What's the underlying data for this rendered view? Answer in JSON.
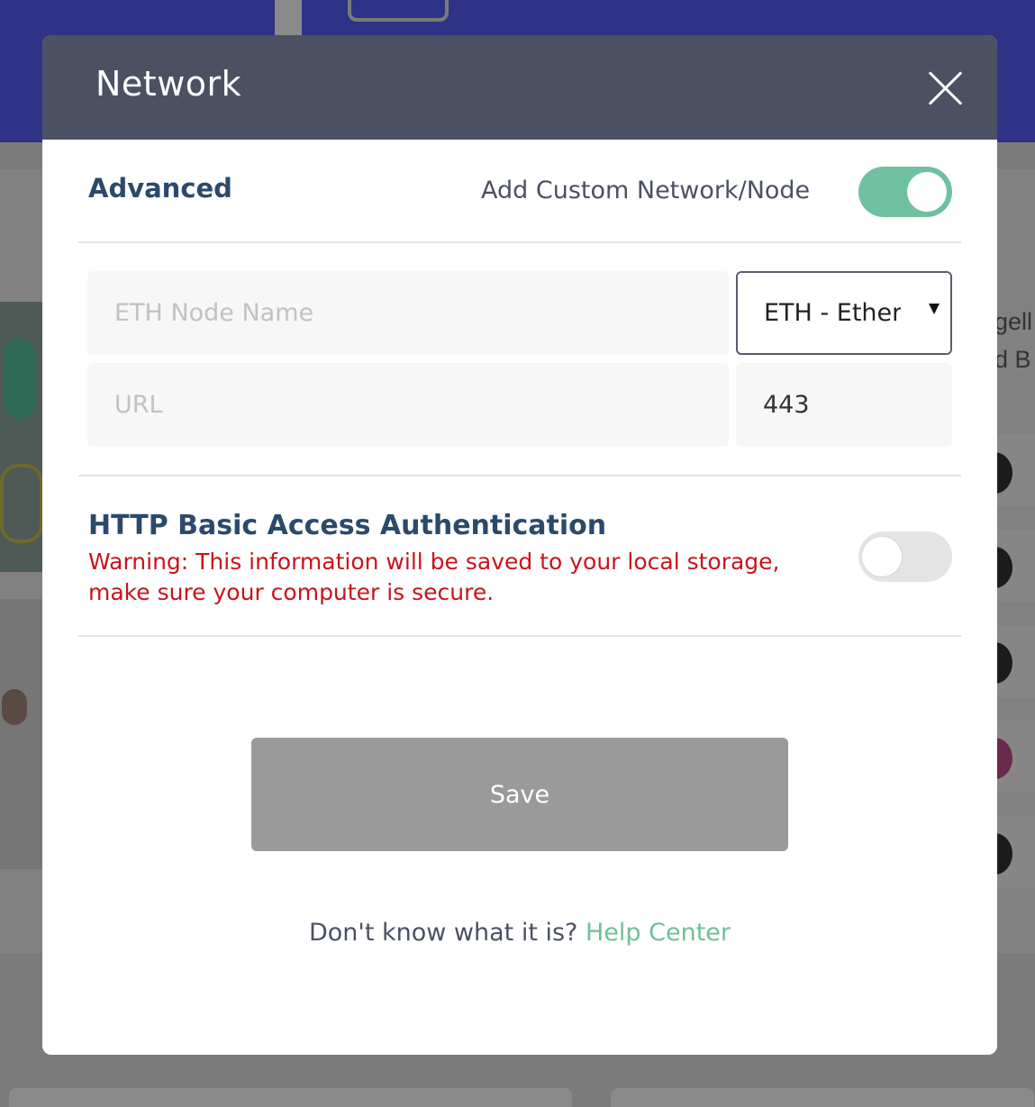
{
  "modal": {
    "title": "Network",
    "advanced": {
      "title": "Advanced",
      "custom_toggle_label": "Add Custom Network/Node",
      "custom_toggle_on": true
    },
    "node_name": {
      "value": "",
      "placeholder": "ETH Node Name"
    },
    "network_select": {
      "selected": "ETH - Ethereum"
    },
    "url": {
      "value": "",
      "placeholder": "URL"
    },
    "port": {
      "value": "443",
      "placeholder": ""
    },
    "auth": {
      "title": "HTTP Basic Access Authentication",
      "warning": "Warning: This information will be saved to your local storage, make sure your computer is secure.",
      "toggle_on": false
    },
    "save_label": "Save",
    "help": {
      "text": "Don't know what it is?",
      "link": "Help Center"
    }
  },
  "colors": {
    "header_bg": "#4b5163",
    "accent": "#6fc0a0",
    "section_title": "#2b4a6b",
    "warning": "#c8141a",
    "save_disabled": "#9a9a9a"
  },
  "background_page": {
    "side_text": [
      "gell",
      "d B"
    ]
  }
}
